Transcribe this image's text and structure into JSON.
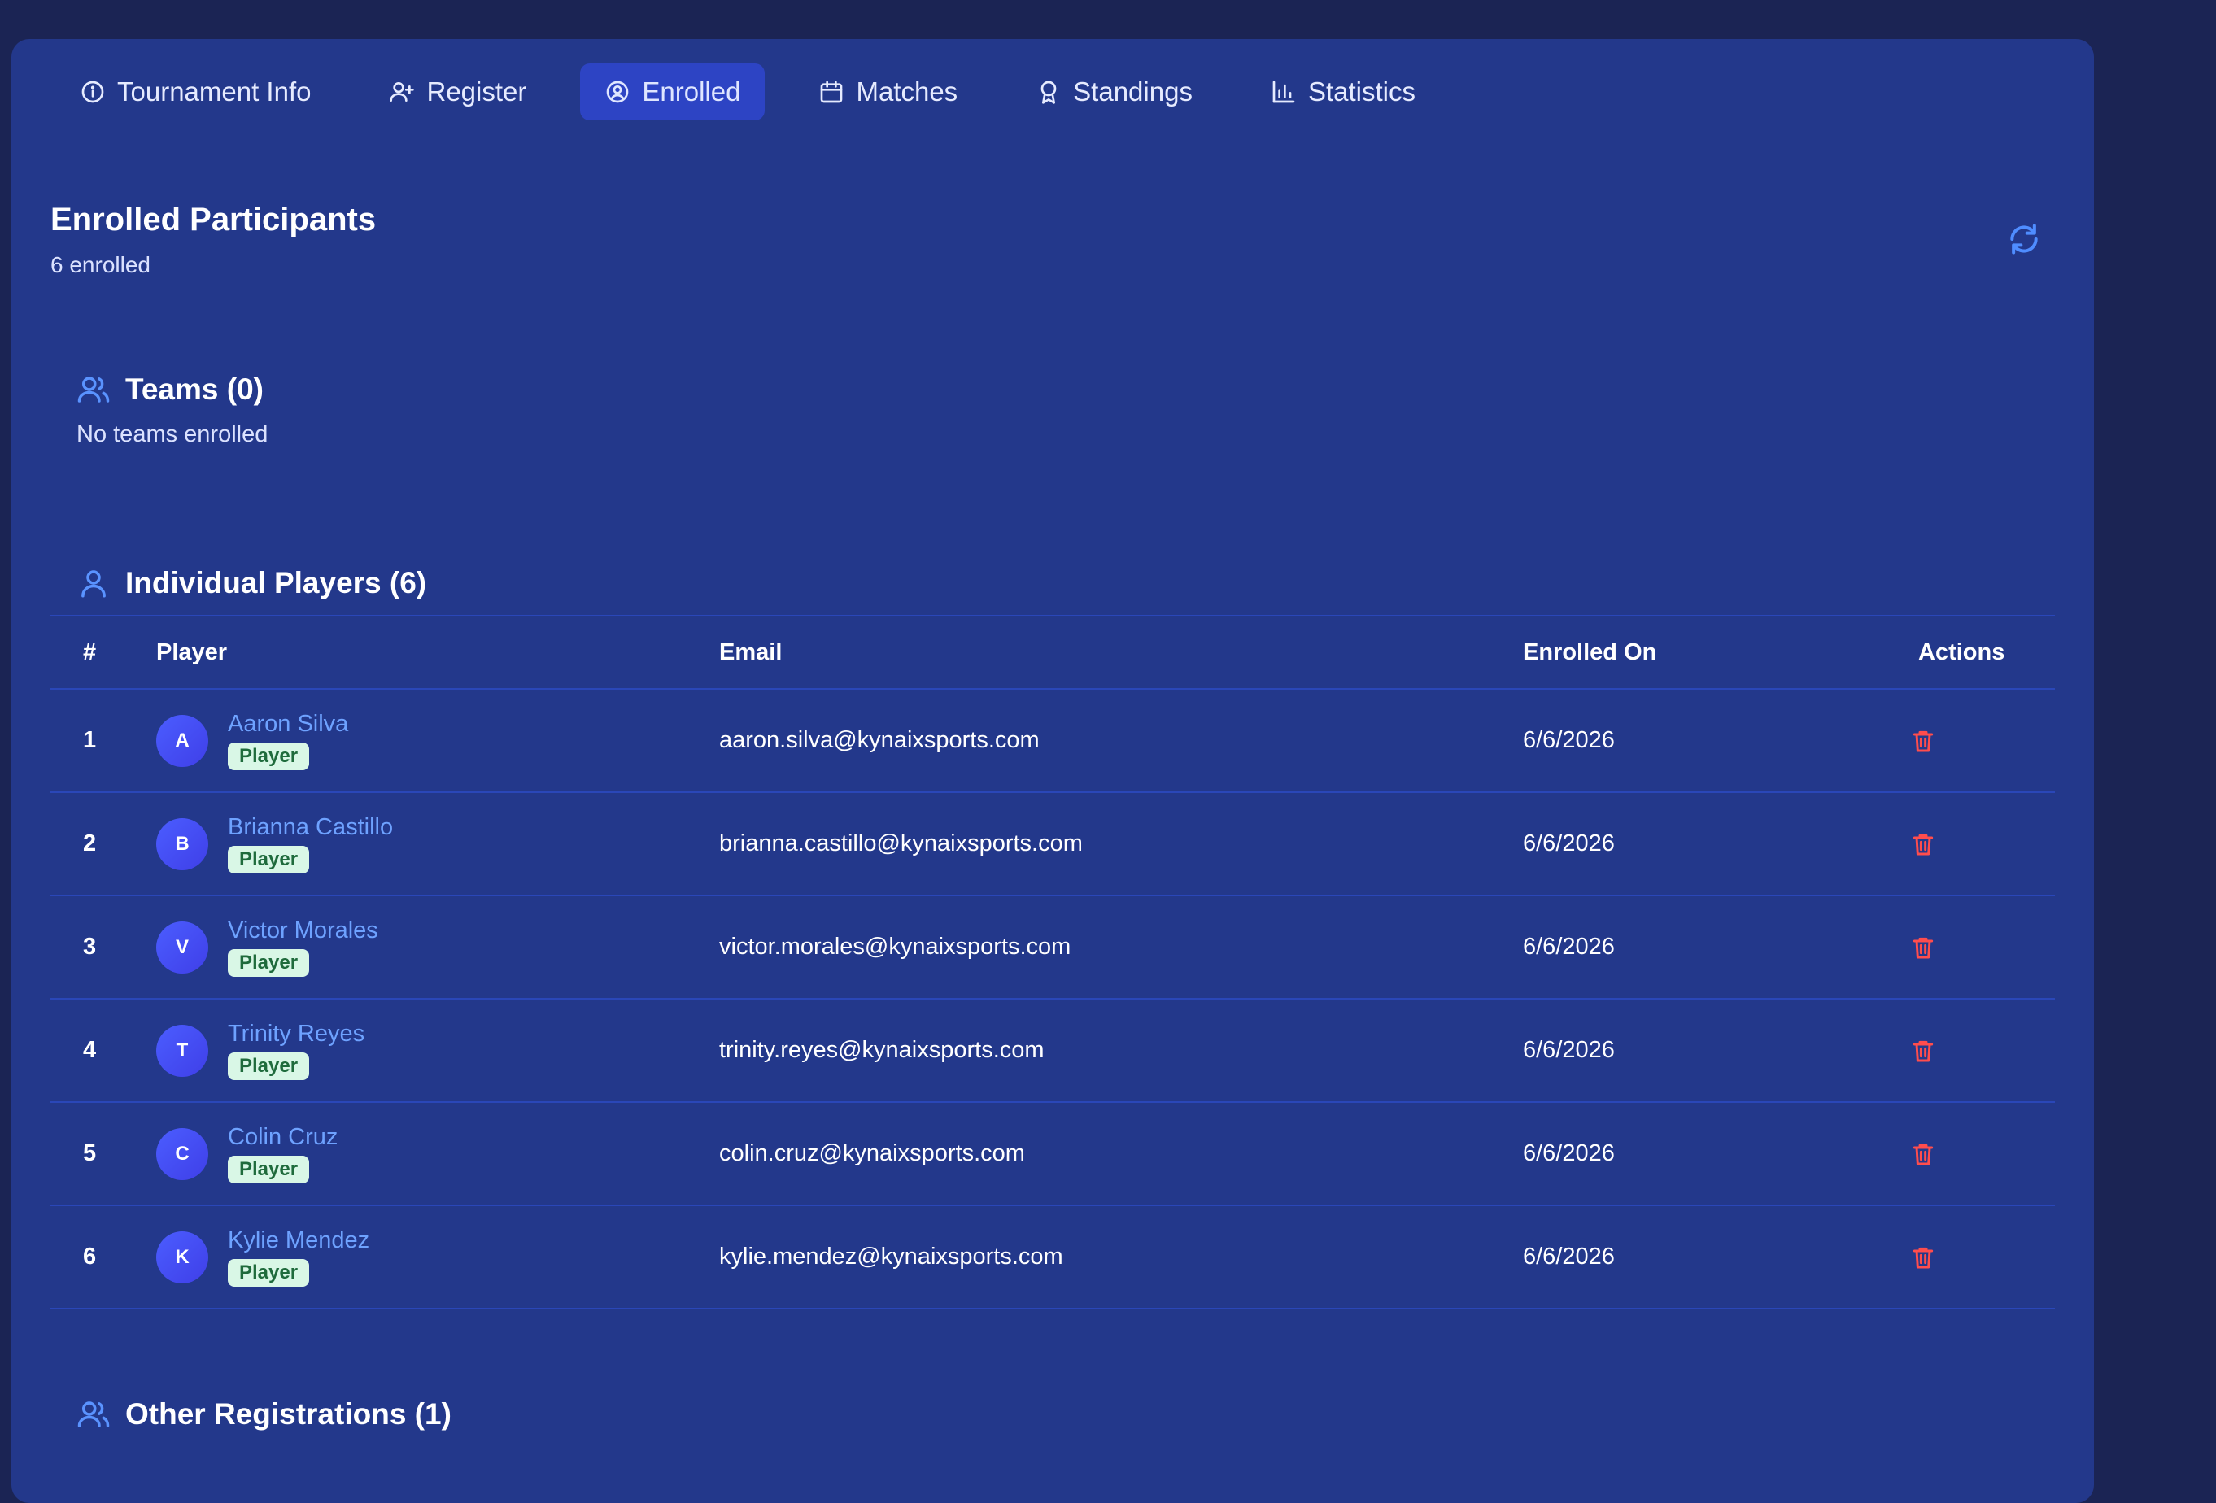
{
  "tabs": [
    {
      "label": "Tournament Info",
      "icon": "info-icon"
    },
    {
      "label": "Register",
      "icon": "user-plus-icon"
    },
    {
      "label": "Enrolled",
      "icon": "user-circle-icon",
      "active": true
    },
    {
      "label": "Matches",
      "icon": "calendar-icon"
    },
    {
      "label": "Standings",
      "icon": "award-icon"
    },
    {
      "label": "Statistics",
      "icon": "bar-chart-icon"
    }
  ],
  "page": {
    "title": "Enrolled Participants",
    "subtitle": "6 enrolled"
  },
  "teams": {
    "heading": "Teams (0)",
    "empty": "No teams enrolled"
  },
  "players": {
    "heading": "Individual Players (6)",
    "columns": {
      "num": "#",
      "player": "Player",
      "email": "Email",
      "date": "Enrolled On",
      "actions": "Actions"
    },
    "rows": [
      {
        "num": "1",
        "initial": "A",
        "name": "Aaron Silva",
        "role": "Player",
        "email": "aaron.silva@kynaixsports.com",
        "date": "6/6/2026"
      },
      {
        "num": "2",
        "initial": "B",
        "name": "Brianna Castillo",
        "role": "Player",
        "email": "brianna.castillo@kynaixsports.com",
        "date": "6/6/2026"
      },
      {
        "num": "3",
        "initial": "V",
        "name": "Victor Morales",
        "role": "Player",
        "email": "victor.morales@kynaixsports.com",
        "date": "6/6/2026"
      },
      {
        "num": "4",
        "initial": "T",
        "name": "Trinity Reyes",
        "role": "Player",
        "email": "trinity.reyes@kynaixsports.com",
        "date": "6/6/2026"
      },
      {
        "num": "5",
        "initial": "C",
        "name": "Colin Cruz",
        "role": "Player",
        "email": "colin.cruz@kynaixsports.com",
        "date": "6/6/2026"
      },
      {
        "num": "6",
        "initial": "K",
        "name": "Kylie Mendez",
        "role": "Player",
        "email": "kylie.mendez@kynaixsports.com",
        "date": "6/6/2026"
      }
    ]
  },
  "other": {
    "heading": "Other Registrations (1)"
  },
  "colors": {
    "background": "#1b2454",
    "panel": "#23388b",
    "active_tab": "#2d44c4",
    "accent": "#5a93ff",
    "link": "#6ea2ff",
    "danger": "#ff4d4d",
    "badge_bg": "#d9f7e6",
    "badge_text": "#1f6b3c"
  }
}
